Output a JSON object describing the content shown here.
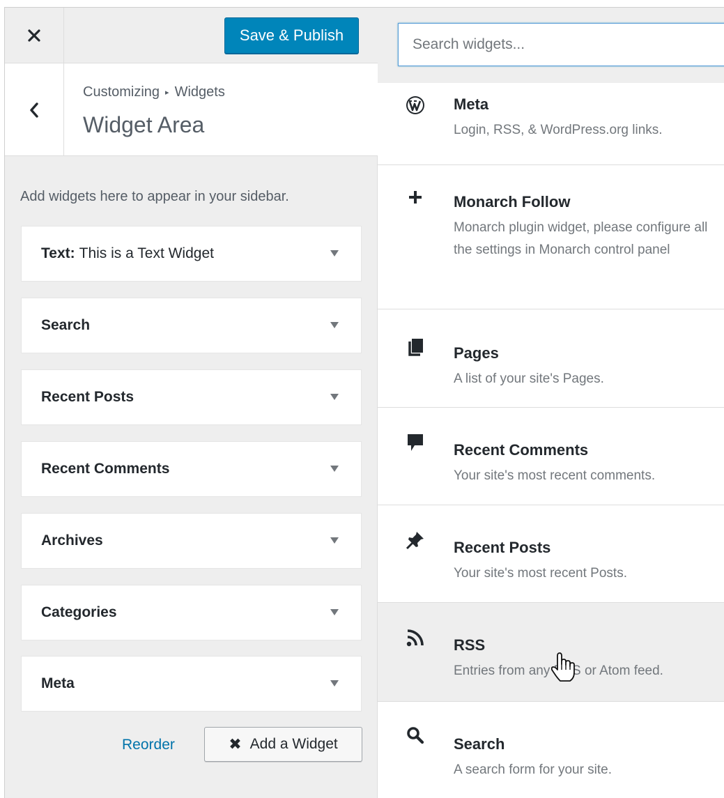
{
  "topbar": {
    "publish_label": "Save & Publish"
  },
  "header": {
    "breadcrumb_root": "Customizing",
    "breadcrumb_current": "Widgets",
    "title": "Widget Area"
  },
  "sidebar": {
    "description": "Add widgets here to appear in your sidebar.",
    "widgets": [
      {
        "label": "Text:",
        "subtitle": "This is a Text Widget"
      },
      {
        "label": "Search",
        "subtitle": ""
      },
      {
        "label": "Recent Posts",
        "subtitle": ""
      },
      {
        "label": "Recent Comments",
        "subtitle": ""
      },
      {
        "label": "Archives",
        "subtitle": ""
      },
      {
        "label": "Categories",
        "subtitle": ""
      },
      {
        "label": "Meta",
        "subtitle": ""
      }
    ],
    "reorder_label": "Reorder",
    "add_widget_label": "Add a Widget"
  },
  "available": {
    "search_placeholder": "Search widgets...",
    "items": [
      {
        "name": "Meta",
        "description": "Login, RSS, & WordPress.org links.",
        "icon": "wordpress-icon"
      },
      {
        "name": "Monarch Follow",
        "description": "Monarch plugin widget, please configure all the settings in Monarch control panel",
        "icon": "plus-icon"
      },
      {
        "name": "Pages",
        "description": "A list of your site's Pages.",
        "icon": "pages-icon"
      },
      {
        "name": "Recent Comments",
        "description": "Your site's most recent comments.",
        "icon": "comment-icon"
      },
      {
        "name": "Recent Posts",
        "description": "Your site's most recent Posts.",
        "icon": "pin-icon"
      },
      {
        "name": "RSS",
        "description": "Entries from any RSS or Atom feed.",
        "icon": "rss-icon"
      },
      {
        "name": "Search",
        "description": "A search form for your site.",
        "icon": "search-icon"
      }
    ]
  }
}
